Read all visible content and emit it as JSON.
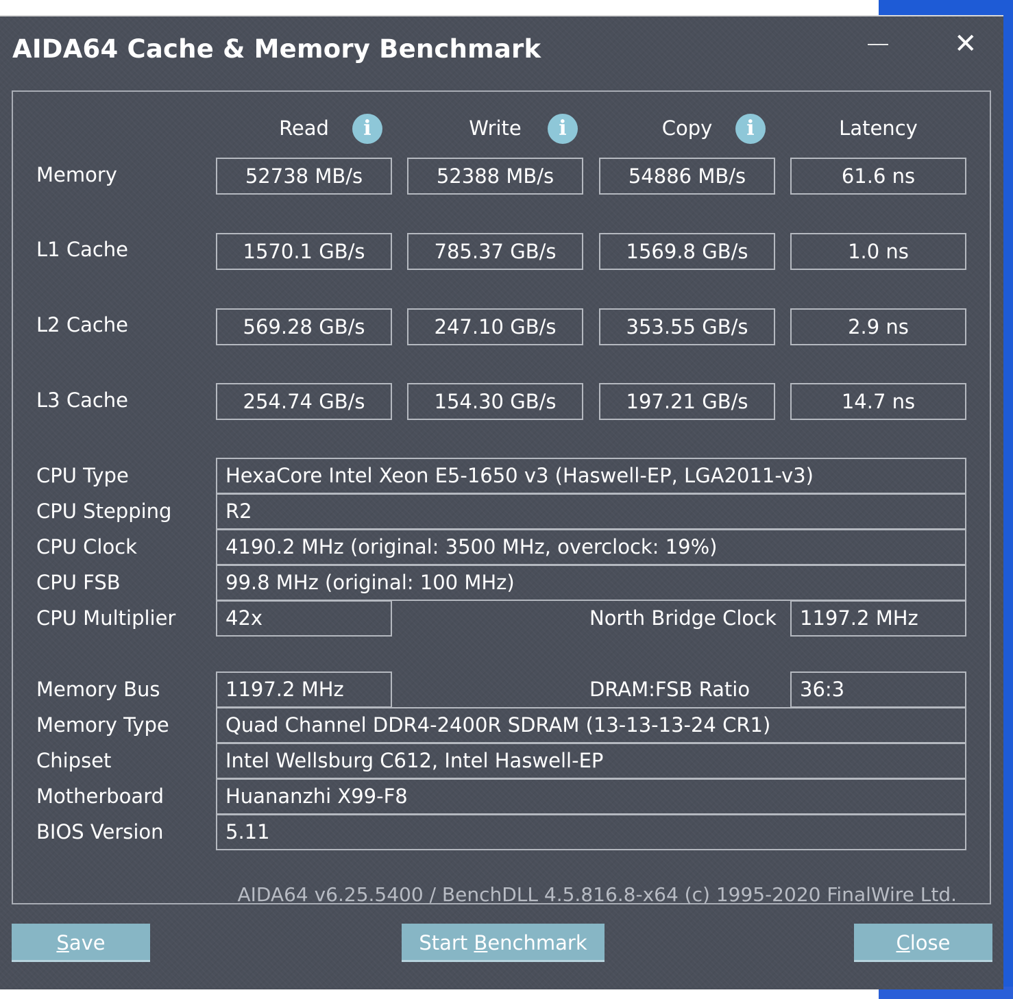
{
  "window": {
    "title": "AIDA64 Cache & Memory Benchmark",
    "minimize_glyph": "—",
    "close_glyph": "✕"
  },
  "columns": [
    {
      "label": "Read",
      "info_icon": "info-icon"
    },
    {
      "label": "Write",
      "info_icon": "info-icon"
    },
    {
      "label": "Copy",
      "info_icon": "info-icon"
    },
    {
      "label": "Latency"
    }
  ],
  "results": [
    {
      "label": "Memory",
      "read": "52738 MB/s",
      "write": "52388 MB/s",
      "copy": "54886 MB/s",
      "latency": "61.6 ns"
    },
    {
      "label": "L1 Cache",
      "read": "1570.1 GB/s",
      "write": "785.37 GB/s",
      "copy": "1569.8 GB/s",
      "latency": "1.0 ns"
    },
    {
      "label": "L2 Cache",
      "read": "569.28 GB/s",
      "write": "247.10 GB/s",
      "copy": "353.55 GB/s",
      "latency": "2.9 ns"
    },
    {
      "label": "L3 Cache",
      "read": "254.74 GB/s",
      "write": "154.30 GB/s",
      "copy": "197.21 GB/s",
      "latency": "14.7 ns"
    }
  ],
  "cpu": {
    "type_label": "CPU Type",
    "type_value": "HexaCore Intel Xeon E5-1650 v3  (Haswell-EP, LGA2011-v3)",
    "stepping_label": "CPU Stepping",
    "stepping_value": "R2",
    "clock_label": "CPU Clock",
    "clock_value": "4190.2 MHz  (original: 3500 MHz, overclock: 19%)",
    "fsb_label": "CPU FSB",
    "fsb_value": "99.8 MHz  (original: 100 MHz)",
    "multiplier_label": "CPU Multiplier",
    "multiplier_value": "42x",
    "nb_clock_label": "North Bridge Clock",
    "nb_clock_value": "1197.2 MHz"
  },
  "memory": {
    "bus_label": "Memory Bus",
    "bus_value": "1197.2 MHz",
    "ratio_label": "DRAM:FSB Ratio",
    "ratio_value": "36:3",
    "type_label": "Memory Type",
    "type_value": "Quad Channel DDR4-2400R SDRAM  (13-13-13-24 CR1)",
    "chipset_label": "Chipset",
    "chipset_value": "Intel Wellsburg C612, Intel Haswell-EP",
    "motherboard_label": "Motherboard",
    "motherboard_value": "Huananzhi X99-F8",
    "bios_label": "BIOS Version",
    "bios_value": "5.11"
  },
  "footer": "AIDA64 v6.25.5400 / BenchDLL 4.5.816.8-x64  (c) 1995-2020 FinalWire Ltd.",
  "buttons": {
    "save_u": "S",
    "save_rest": "ave",
    "start_pre": "Start ",
    "start_u": "B",
    "start_rest": "enchmark",
    "close_u": "C",
    "close_rest": "lose"
  },
  "colors": {
    "window_bg": "#4a4f5a",
    "button_bg": "#87b6c5",
    "info_icon": "#8ec7d8",
    "desktop_accent": "#1e5bd6"
  }
}
